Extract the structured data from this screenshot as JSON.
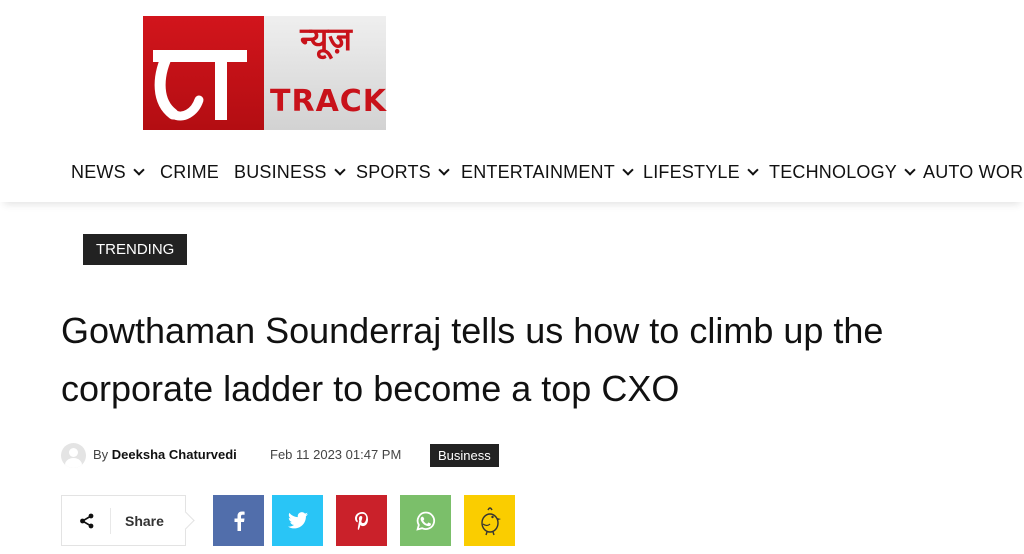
{
  "logo": {
    "hindi": "न्यूज़",
    "track": "TRACK",
    "colors": {
      "red": "#c8121a",
      "gray": "#e0e0e0"
    }
  },
  "nav": {
    "items": [
      {
        "label": "NEWS",
        "dropdown": true
      },
      {
        "label": "CRIME",
        "dropdown": false
      },
      {
        "label": "BUSINESS",
        "dropdown": true
      },
      {
        "label": "SPORTS",
        "dropdown": true
      },
      {
        "label": "ENTERTAINMENT",
        "dropdown": true
      },
      {
        "label": "LIFESTYLE",
        "dropdown": true
      },
      {
        "label": "TECHNOLOGY",
        "dropdown": true
      },
      {
        "label": "AUTO WORLD",
        "dropdown": false
      }
    ]
  },
  "article": {
    "tag": "TRENDING",
    "title": "Gowthaman Sounderraj tells us how to climb up the corporate ladder to become a top CXO",
    "by_label": "By",
    "author": "Deeksha Chaturvedi",
    "date": "Feb 11 2023 01:47 PM",
    "category": "Business"
  },
  "share": {
    "label": "Share",
    "buttons": [
      {
        "name": "facebook",
        "icon": "facebook-icon",
        "color": "#516eab"
      },
      {
        "name": "twitter",
        "icon": "twitter-icon",
        "color": "#29c5f6"
      },
      {
        "name": "pinterest",
        "icon": "pinterest-icon",
        "color": "#ca212a"
      },
      {
        "name": "whatsapp",
        "icon": "whatsapp-icon",
        "color": "#7bbf6a"
      },
      {
        "name": "koo",
        "icon": "koo-bird-icon",
        "color": "#facd00"
      }
    ]
  }
}
